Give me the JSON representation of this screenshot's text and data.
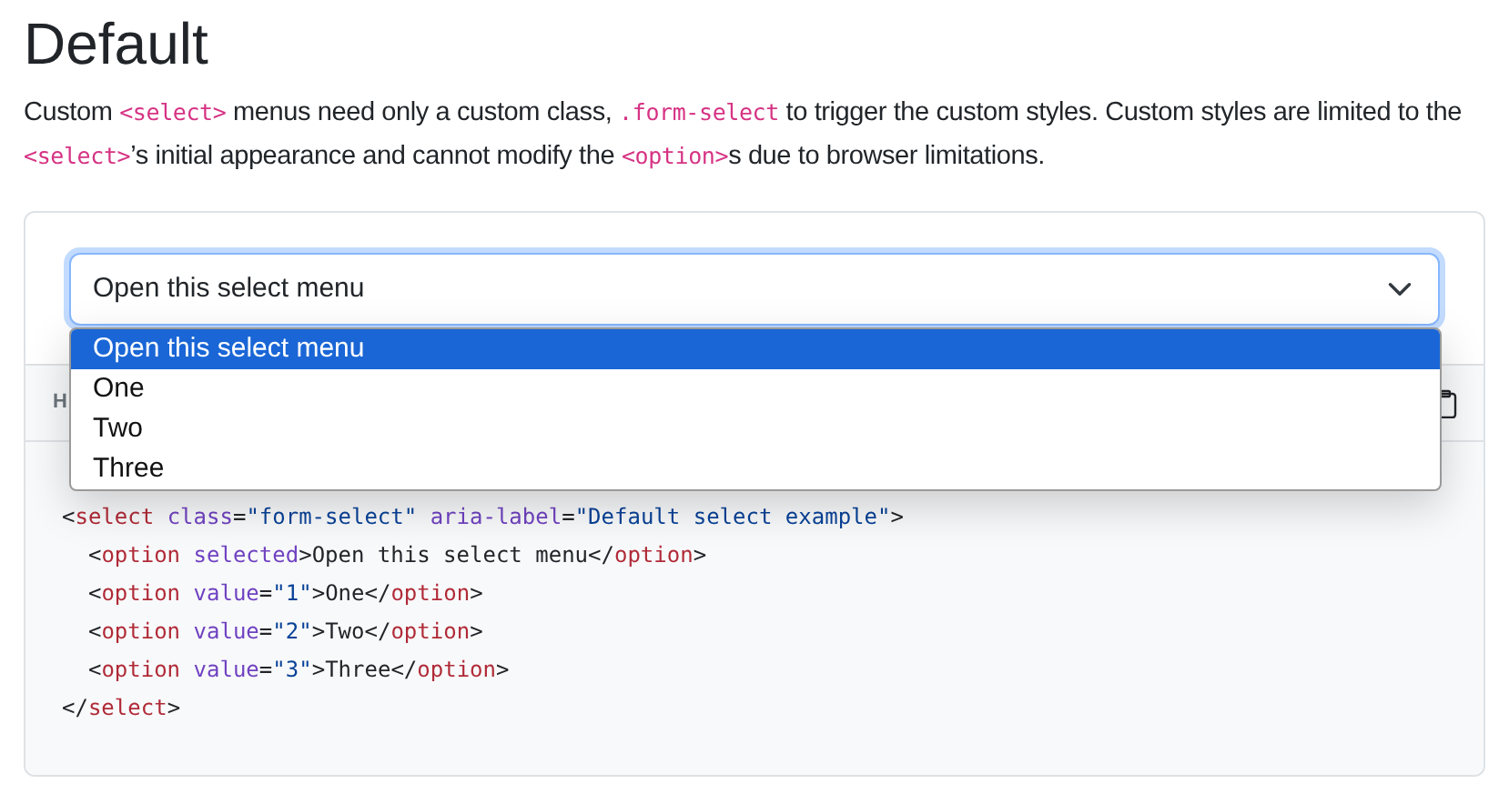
{
  "heading": "Default",
  "description": [
    {
      "kind": "text",
      "text": "Custom "
    },
    {
      "kind": "code",
      "text": "<select>"
    },
    {
      "kind": "text",
      "text": " menus need only a custom class, "
    },
    {
      "kind": "code",
      "text": ".form-select"
    },
    {
      "kind": "text",
      "text": " to trigger the custom styles. Custom styles are limited to the "
    },
    {
      "kind": "code",
      "text": "<select>"
    },
    {
      "kind": "text",
      "text": "’s initial appearance and cannot modify the "
    },
    {
      "kind": "code",
      "text": "<option>"
    },
    {
      "kind": "text",
      "text": "s due to browser limitations."
    }
  ],
  "select": {
    "value": "Open this select menu",
    "focused": true,
    "expanded": true,
    "options": [
      {
        "label": "Open this select menu",
        "selected": true
      },
      {
        "label": "One",
        "selected": false
      },
      {
        "label": "Two",
        "selected": false
      },
      {
        "label": "Three",
        "selected": false
      }
    ]
  },
  "code_toolbar": {
    "label": "H"
  },
  "code_lines": [
    [
      {
        "kind": "punct",
        "text": "<"
      },
      {
        "kind": "tag",
        "text": "select"
      },
      {
        "kind": "attr",
        "text": " class"
      },
      {
        "kind": "punct",
        "text": "="
      },
      {
        "kind": "string",
        "text": "\"form-select\""
      },
      {
        "kind": "attr",
        "text": " aria-label"
      },
      {
        "kind": "punct",
        "text": "="
      },
      {
        "kind": "string",
        "text": "\"Default select example\""
      },
      {
        "kind": "punct",
        "text": ">"
      }
    ],
    [
      {
        "kind": "punct",
        "text": "  <"
      },
      {
        "kind": "tag",
        "text": "option"
      },
      {
        "kind": "attr",
        "text": " selected"
      },
      {
        "kind": "punct",
        "text": ">"
      },
      {
        "kind": "text",
        "text": "Open this select menu"
      },
      {
        "kind": "punct",
        "text": "</"
      },
      {
        "kind": "tag",
        "text": "option"
      },
      {
        "kind": "punct",
        "text": ">"
      }
    ],
    [
      {
        "kind": "punct",
        "text": "  <"
      },
      {
        "kind": "tag",
        "text": "option"
      },
      {
        "kind": "attr",
        "text": " value"
      },
      {
        "kind": "punct",
        "text": "="
      },
      {
        "kind": "string",
        "text": "\"1\""
      },
      {
        "kind": "punct",
        "text": ">"
      },
      {
        "kind": "text",
        "text": "One"
      },
      {
        "kind": "punct",
        "text": "</"
      },
      {
        "kind": "tag",
        "text": "option"
      },
      {
        "kind": "punct",
        "text": ">"
      }
    ],
    [
      {
        "kind": "punct",
        "text": "  <"
      },
      {
        "kind": "tag",
        "text": "option"
      },
      {
        "kind": "attr",
        "text": " value"
      },
      {
        "kind": "punct",
        "text": "="
      },
      {
        "kind": "string",
        "text": "\"2\""
      },
      {
        "kind": "punct",
        "text": ">"
      },
      {
        "kind": "text",
        "text": "Two"
      },
      {
        "kind": "punct",
        "text": "</"
      },
      {
        "kind": "tag",
        "text": "option"
      },
      {
        "kind": "punct",
        "text": ">"
      }
    ],
    [
      {
        "kind": "punct",
        "text": "  <"
      },
      {
        "kind": "tag",
        "text": "option"
      },
      {
        "kind": "attr",
        "text": " value"
      },
      {
        "kind": "punct",
        "text": "="
      },
      {
        "kind": "string",
        "text": "\"3\""
      },
      {
        "kind": "punct",
        "text": ">"
      },
      {
        "kind": "text",
        "text": "Three"
      },
      {
        "kind": "punct",
        "text": "</"
      },
      {
        "kind": "tag",
        "text": "option"
      },
      {
        "kind": "punct",
        "text": ">"
      }
    ],
    [
      {
        "kind": "punct",
        "text": "</"
      },
      {
        "kind": "tag",
        "text": "select"
      },
      {
        "kind": "punct",
        "text": ">"
      }
    ]
  ]
}
